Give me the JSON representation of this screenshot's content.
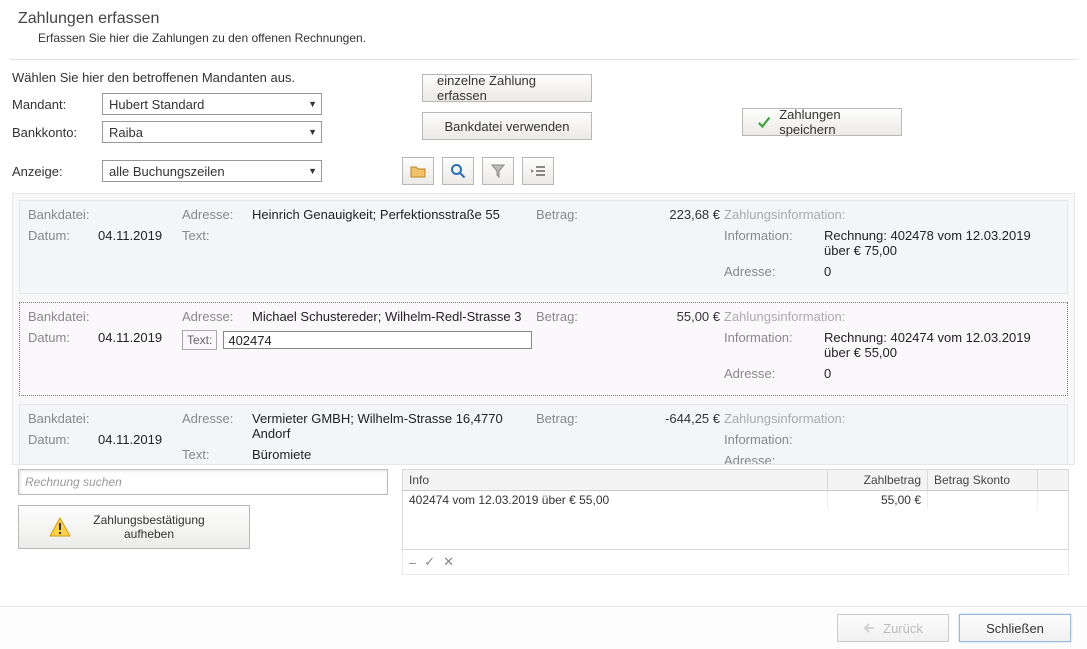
{
  "header": {
    "title": "Zahlungen erfassen",
    "subtitle": "Erfassen Sie hier die Zahlungen zu den offenen Rechnungen."
  },
  "form": {
    "instruction": "Wählen Sie hier den betroffenen Mandanten aus.",
    "mandant_label": "Mandant:",
    "mandant_value": "Hubert Standard",
    "bankkonto_label": "Bankkonto:",
    "bankkonto_value": "Raiba",
    "anzeige_label": "Anzeige:",
    "anzeige_value": "alle Buchungszeilen"
  },
  "buttons": {
    "single": "einzelne Zahlung erfassen",
    "bankfile": "Bankdatei verwenden",
    "save": "Zahlungen speichern"
  },
  "labels": {
    "bankdatei": "Bankdatei:",
    "datum": "Datum:",
    "adresse": "Adresse:",
    "text": "Text:",
    "betrag": "Betrag:",
    "zinfo": "Zahlungsinformation:",
    "information": "Information:",
    "info_adresse": "Adresse:"
  },
  "entries": [
    {
      "datum": "04.11.2019",
      "adresse": "Heinrich Genauigkeit; Perfektionsstraße 55",
      "text": "",
      "betrag": "223,68 €",
      "information": "Rechnung: 402478 vom 12.03.2019 über € 75,00",
      "info_adresse": "0",
      "checked": true,
      "selected": false
    },
    {
      "datum": "04.11.2019",
      "adresse": "Michael Schustereder; Wilhelm-Redl-Strasse 3",
      "text": "402474",
      "betrag": "55,00 €",
      "information": "Rechnung: 402474 vom 12.03.2019 über € 55,00",
      "info_adresse": "0",
      "checked": true,
      "selected": true
    },
    {
      "datum": "04.11.2019",
      "adresse": "Vermieter GMBH; Wilhelm-Strasse 16,4770 Andorf",
      "text": "Büromiete",
      "betrag": "-644,25 €",
      "information": "",
      "info_adresse": "",
      "checked": false,
      "selected": false
    }
  ],
  "search": {
    "placeholder": "Rechnung suchen"
  },
  "cancel_confirm": "Zahlungsbestätigung aufheben",
  "grid": {
    "headers": {
      "info": "Info",
      "zahlbetrag": "Zahlbetrag",
      "skonto": "Betrag Skonto"
    },
    "rows": [
      {
        "info": "402474 vom 12.03.2019 über € 55,00",
        "zahlbetrag": "55,00 €",
        "skonto": ""
      }
    ],
    "footer_icons": {
      "minus": "–",
      "check": "✓",
      "x": "✕"
    }
  },
  "nav": {
    "back": "Zurück",
    "close": "Schließen"
  }
}
